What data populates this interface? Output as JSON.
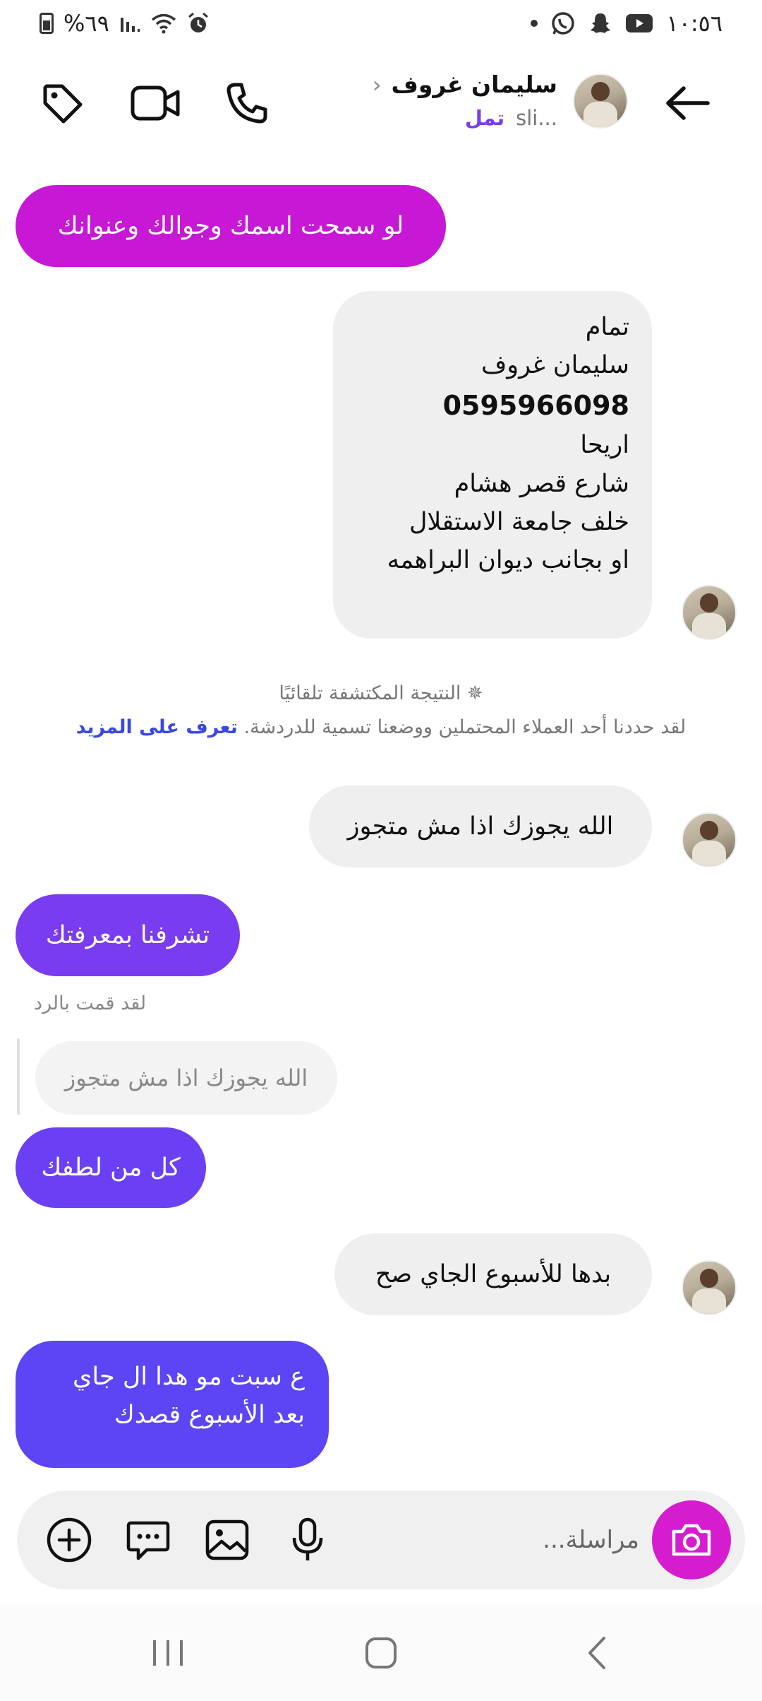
{
  "status_bar": {
    "time": "١٠:٥٦",
    "battery": "%٦٩",
    "icons": [
      "youtube-icon",
      "snapchat-icon",
      "whatsapp-icon",
      "alarm-icon",
      "wifi-icon",
      "signal-icon",
      "battery-icon"
    ]
  },
  "header": {
    "name": "سليمان غروف",
    "status": "تمل",
    "username": "sli..."
  },
  "messages": {
    "m1": "لو سمحت اسمك وجوالك وعنوانك",
    "m2": {
      "line1": "تمام",
      "line2": "سليمان غروف",
      "line3": "0595966098",
      "line4": "اريحا",
      "line5": "شارع قصر هشام",
      "line6": "خلف جامعة الاستقلال",
      "line7": "او بجانب ديوان البراهمه"
    },
    "m3": "الله يجوزك اذا مش متجوز",
    "m4": "تشرفنا بمعرفتك",
    "m5": "كل من لطفك",
    "m6": "بدها للأسبوع الجاي صح",
    "m7": {
      "line1": "ع سبت مو هدا ال جاي",
      "line2": "بعد الأسبوع قصدك"
    }
  },
  "system_notice": {
    "title": "النتيجة المكتشفة تلقائيًا",
    "body": "لقد حددنا أحد العملاء المحتملين ووضعنا تسمية للدردشة.",
    "link": "تعرف على المزيد"
  },
  "reply": {
    "label": "لقد قمت بالرد",
    "quote": "الله يجوزك اذا مش متجوز"
  },
  "composer": {
    "placeholder": "مراسلة..."
  },
  "colors": {
    "outgoing_magenta": "#c718d6",
    "outgoing_purple": "#7a3cf0",
    "outgoing_blue": "#5b45f5",
    "incoming": "#efefef",
    "camera": "#d61ccf",
    "link": "#3847e8"
  }
}
